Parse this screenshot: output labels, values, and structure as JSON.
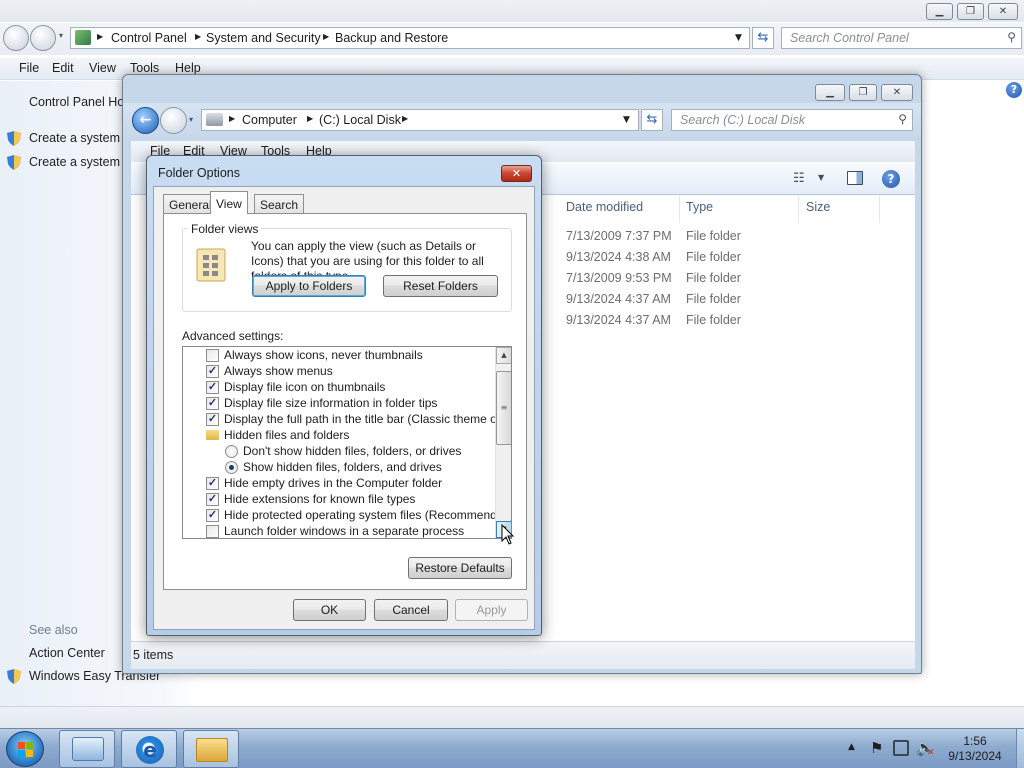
{
  "control_panel": {
    "breadcrumb": [
      "Control Panel",
      "System and Security",
      "Backup and Restore"
    ],
    "search_placeholder": "Search Control Panel",
    "menu": [
      "File",
      "Edit",
      "View",
      "Tools",
      "Help"
    ],
    "left_pane": {
      "home_link": "Control Panel Hor",
      "tasks": [
        "Create a system in",
        "Create a system re"
      ],
      "see_also_heading": "See also",
      "see_also": [
        "Action Center",
        "Windows Easy Transfer"
      ]
    }
  },
  "explorer": {
    "breadcrumb": [
      "Computer",
      "(C:) Local Disk"
    ],
    "search_placeholder": "Search (C:) Local Disk",
    "menu": [
      "File",
      "Edit",
      "View",
      "Tools",
      "Help"
    ],
    "columns": [
      "Date modified",
      "Type",
      "Size"
    ],
    "rows": [
      {
        "date": "7/13/2009 7:37 PM",
        "type": "File folder"
      },
      {
        "date": "9/13/2024 4:38 AM",
        "type": "File folder"
      },
      {
        "date": "7/13/2009 9:53 PM",
        "type": "File folder"
      },
      {
        "date": "9/13/2024 4:37 AM",
        "type": "File folder"
      },
      {
        "date": "9/13/2024 4:37 AM",
        "type": "File folder"
      }
    ],
    "status": "5 items"
  },
  "dialog": {
    "title": "Folder Options",
    "close_glyph": "✕",
    "tabs": [
      "General",
      "View",
      "Search"
    ],
    "active_tab": "View",
    "folder_views": {
      "legend": "Folder views",
      "description": "You can apply the view (such as Details or Icons) that you are using for this folder to all folders of this type.",
      "apply_button": "Apply to Folders",
      "reset_button": "Reset Folders"
    },
    "advanced_label": "Advanced settings:",
    "advanced_items": [
      {
        "text": "Always show icons, never thumbnails",
        "kind": "checkbox",
        "checked": false
      },
      {
        "text": "Always show menus",
        "kind": "checkbox",
        "checked": true
      },
      {
        "text": "Display file icon on thumbnails",
        "kind": "checkbox",
        "checked": true
      },
      {
        "text": "Display file size information in folder tips",
        "kind": "checkbox",
        "checked": true
      },
      {
        "text": "Display the full path in the title bar (Classic theme only)",
        "kind": "checkbox",
        "checked": true
      },
      {
        "text": "Hidden files and folders",
        "kind": "folder"
      },
      {
        "text": "Don't show hidden files, folders, or drives",
        "kind": "radio",
        "checked": false
      },
      {
        "text": "Show hidden files, folders, and drives",
        "kind": "radio",
        "checked": true
      },
      {
        "text": "Hide empty drives in the Computer folder",
        "kind": "checkbox",
        "checked": true
      },
      {
        "text": "Hide extensions for known file types",
        "kind": "checkbox",
        "checked": true
      },
      {
        "text": "Hide protected operating system files (Recommended)",
        "kind": "checkbox",
        "checked": true
      },
      {
        "text": "Launch folder windows in a separate process",
        "kind": "checkbox",
        "checked": false
      }
    ],
    "restore_defaults": "Restore Defaults",
    "ok": "OK",
    "cancel": "Cancel",
    "apply": "Apply"
  },
  "taskbar": {
    "time": "1:56",
    "date": "9/13/2024"
  }
}
